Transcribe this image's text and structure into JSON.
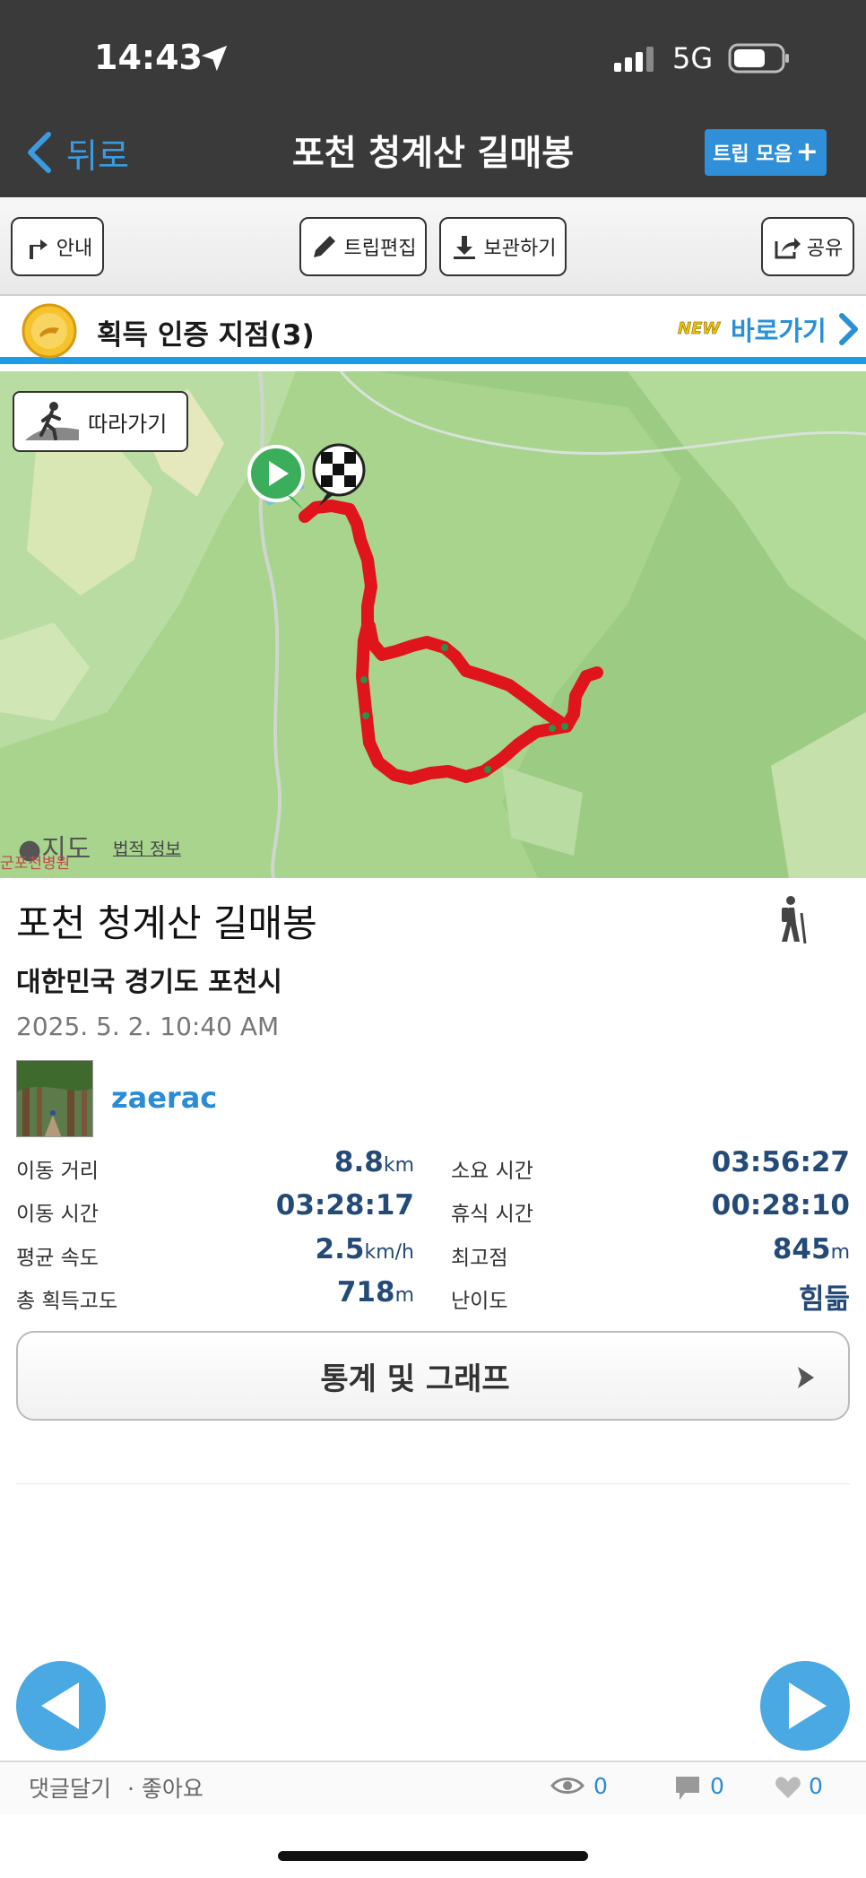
{
  "status_bar": {
    "time": "14:43",
    "network": "5G"
  },
  "nav": {
    "back_label": "뒤로",
    "title": "포천 청계산 길매봉",
    "trip_collection_label": "트립 모음"
  },
  "toolbar": {
    "guide_label": "안내",
    "edit_label": "트립편집",
    "save_label": "보관하기",
    "share_label": "공유"
  },
  "badges": {
    "title": "획득 인증 지점(3)",
    "new_tag": "NEW",
    "link_label": "바로가기"
  },
  "map": {
    "follow_label": "따라가기",
    "attribution": "지도",
    "legal_label": "법적 정보",
    "region_label": "군포천병원"
  },
  "trip": {
    "name": "포천 청계산 길매봉",
    "location": "대한민국 경기도 포천시",
    "datetime": "2025. 5. 2. 10:40 AM",
    "activity_icon": "hiker-icon"
  },
  "user": {
    "name": "zaerac"
  },
  "stats": {
    "distance": {
      "label": "이동 거리",
      "value": "8.8",
      "unit": "km"
    },
    "elapsed": {
      "label": "소요 시간",
      "value": "03:56:27"
    },
    "moving_time": {
      "label": "이동 시간",
      "value": "03:28:17"
    },
    "rest_time": {
      "label": "휴식 시간",
      "value": "00:28:10"
    },
    "avg_speed": {
      "label": "평균 속도",
      "value": "2.5",
      "unit": "km/h"
    },
    "max_elevation": {
      "label": "최고점",
      "value": "845",
      "unit": "m"
    },
    "total_ascent": {
      "label": "총 획득고도",
      "value": "718",
      "unit": "m"
    },
    "difficulty": {
      "label": "난이도",
      "value": "힘듦"
    }
  },
  "stats_button_label": "통계 및 그래프",
  "footer": {
    "comment_label": "댓글달기",
    "like_label": "· 좋아요",
    "views": "0",
    "comments": "0",
    "likes": "0"
  },
  "colors": {
    "accent": "#2a8bd6",
    "route": "#e0141b",
    "nav_bg": "#3a3a3a",
    "value_text": "#244a78"
  }
}
